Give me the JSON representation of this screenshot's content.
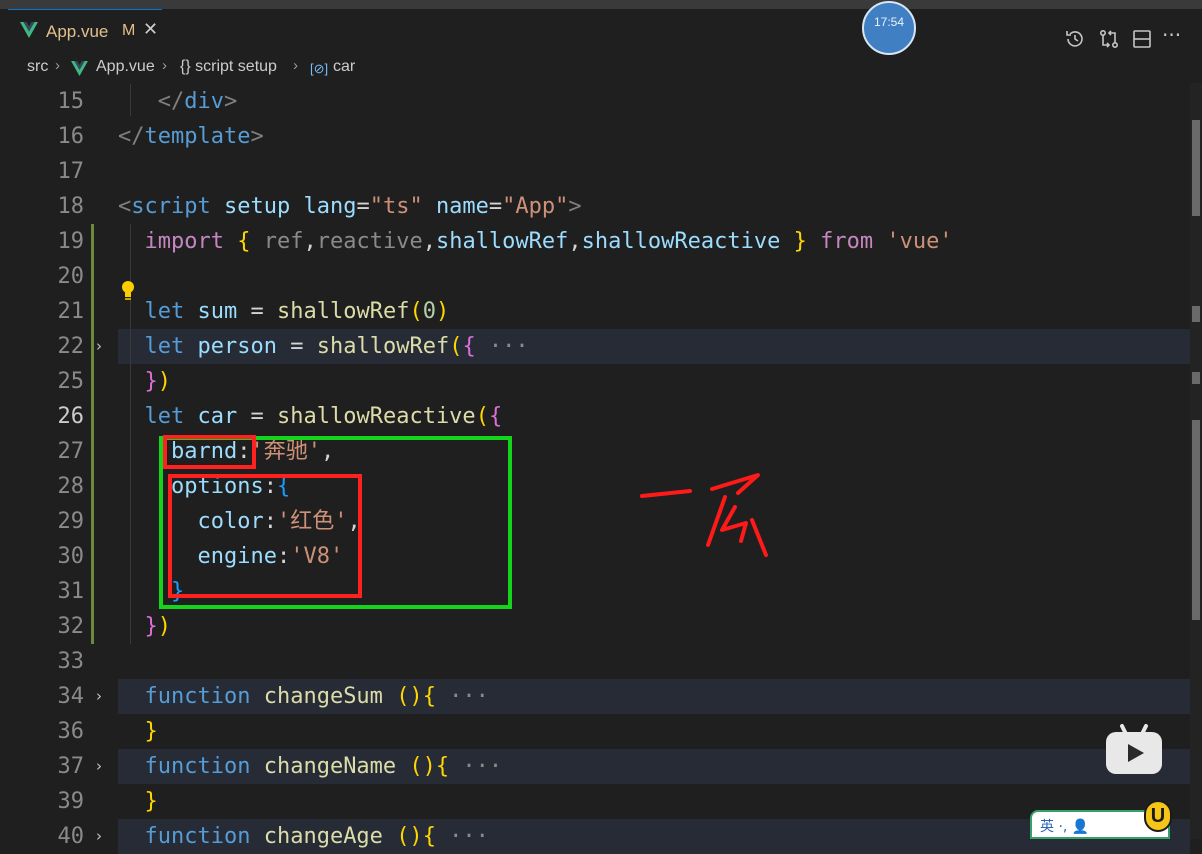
{
  "tab": {
    "label": "App.vue",
    "modified": "M",
    "close": "✕"
  },
  "clock": "17:54",
  "breadcrumb": {
    "items": [
      "src",
      "App.vue",
      "{} script setup",
      "car"
    ]
  },
  "annotation": {
    "handwriting": "一层"
  },
  "ime": {
    "text": "英 ·, 👤",
    "badge": "U"
  },
  "editor": {
    "current_line": "26",
    "lines": [
      {
        "n": "15",
        "tokens": [
          [
            "   ",
            ""
          ],
          [
            "</",
            "t-tag"
          ],
          [
            "div",
            "t-tagname"
          ],
          [
            ">",
            "t-tag"
          ]
        ]
      },
      {
        "n": "16",
        "tokens": [
          [
            "</",
            "t-tag"
          ],
          [
            "template",
            "t-tagname"
          ],
          [
            ">",
            "t-tag"
          ]
        ]
      },
      {
        "n": "17",
        "tokens": []
      },
      {
        "n": "18",
        "tokens": [
          [
            "<",
            "t-tag"
          ],
          [
            "script",
            "t-tagname"
          ],
          [
            " ",
            ""
          ],
          [
            "setup",
            "t-attr"
          ],
          [
            " ",
            ""
          ],
          [
            "lang",
            "t-attr"
          ],
          [
            "=",
            ""
          ],
          [
            "\"ts\"",
            "t-str"
          ],
          [
            " ",
            ""
          ],
          [
            "name",
            "t-attr"
          ],
          [
            "=",
            ""
          ],
          [
            "\"App\"",
            "t-str"
          ],
          [
            ">",
            "t-tag"
          ]
        ]
      },
      {
        "n": "19",
        "tokens": [
          [
            "  ",
            ""
          ],
          [
            "import",
            "t-imp"
          ],
          [
            " ",
            ""
          ],
          [
            "{",
            "t-b1"
          ],
          [
            " ",
            ""
          ],
          [
            "ref",
            "t-dim"
          ],
          [
            ",",
            ""
          ],
          [
            "reactive",
            "t-dim"
          ],
          [
            ",",
            ""
          ],
          [
            "shallowRef",
            "t-var"
          ],
          [
            ",",
            ""
          ],
          [
            "shallowReactive",
            "t-var"
          ],
          [
            " ",
            ""
          ],
          [
            "}",
            "t-b1"
          ],
          [
            " ",
            ""
          ],
          [
            "from",
            "t-imp"
          ],
          [
            " ",
            ""
          ],
          [
            "'vue'",
            "t-str"
          ]
        ]
      },
      {
        "n": "20",
        "tokens": []
      },
      {
        "n": "21",
        "tokens": [
          [
            "  ",
            ""
          ],
          [
            "let",
            "t-kw"
          ],
          [
            " ",
            ""
          ],
          [
            "sum",
            "t-var"
          ],
          [
            " = ",
            ""
          ],
          [
            "shallowRef",
            "t-fn"
          ],
          [
            "(",
            "t-b1"
          ],
          [
            "0",
            "t-num"
          ],
          [
            ")",
            "t-b1"
          ]
        ]
      },
      {
        "n": "22",
        "fold": true,
        "hl": true,
        "tokens": [
          [
            "  ",
            ""
          ],
          [
            "let",
            "t-kw"
          ],
          [
            " ",
            ""
          ],
          [
            "person",
            "t-var"
          ],
          [
            " = ",
            ""
          ],
          [
            "shallowRef",
            "t-fn"
          ],
          [
            "(",
            "t-b1"
          ],
          [
            "{",
            "t-b2"
          ],
          [
            " ···",
            "t-dim"
          ]
        ]
      },
      {
        "n": "25",
        "tokens": [
          [
            "  ",
            ""
          ],
          [
            "}",
            "t-b2"
          ],
          [
            ")",
            "t-b1"
          ]
        ]
      },
      {
        "n": "26",
        "tokens": [
          [
            "  ",
            ""
          ],
          [
            "let",
            "t-kw"
          ],
          [
            " ",
            ""
          ],
          [
            "car",
            "t-var"
          ],
          [
            " = ",
            ""
          ],
          [
            "shallowReactive",
            "t-fn"
          ],
          [
            "(",
            "t-b1"
          ],
          [
            "{",
            "t-b2"
          ]
        ]
      },
      {
        "n": "27",
        "tokens": [
          [
            "    ",
            ""
          ],
          [
            "barnd",
            "t-prop"
          ],
          [
            ":",
            ""
          ],
          [
            "'奔驰'",
            "t-str"
          ],
          [
            ",",
            ""
          ]
        ]
      },
      {
        "n": "28",
        "tokens": [
          [
            "    ",
            ""
          ],
          [
            "options",
            "t-prop"
          ],
          [
            ":",
            ""
          ],
          [
            "{",
            "t-b3"
          ]
        ]
      },
      {
        "n": "29",
        "tokens": [
          [
            "      ",
            ""
          ],
          [
            "color",
            "t-prop"
          ],
          [
            ":",
            ""
          ],
          [
            "'红色'",
            "t-str"
          ],
          [
            ",",
            ""
          ]
        ]
      },
      {
        "n": "30",
        "tokens": [
          [
            "      ",
            ""
          ],
          [
            "engine",
            "t-prop"
          ],
          [
            ":",
            ""
          ],
          [
            "'V8'",
            "t-str"
          ]
        ]
      },
      {
        "n": "31",
        "tokens": [
          [
            "    ",
            ""
          ],
          [
            "}",
            "t-b3"
          ]
        ]
      },
      {
        "n": "32",
        "tokens": [
          [
            "  ",
            ""
          ],
          [
            "}",
            "t-b2"
          ],
          [
            ")",
            "t-b1"
          ]
        ]
      },
      {
        "n": "33",
        "tokens": []
      },
      {
        "n": "34",
        "fold": true,
        "hl": true,
        "tokens": [
          [
            "  ",
            ""
          ],
          [
            "function",
            "t-kw"
          ],
          [
            " ",
            ""
          ],
          [
            "changeSum",
            "t-fn"
          ],
          [
            " ",
            ""
          ],
          [
            "()",
            "t-b1"
          ],
          [
            "{",
            "t-b1"
          ],
          [
            " ···",
            "t-dim"
          ]
        ]
      },
      {
        "n": "36",
        "tokens": [
          [
            "  ",
            ""
          ],
          [
            "}",
            "t-b1"
          ]
        ]
      },
      {
        "n": "37",
        "fold": true,
        "hl": true,
        "tokens": [
          [
            "  ",
            ""
          ],
          [
            "function",
            "t-kw"
          ],
          [
            " ",
            ""
          ],
          [
            "changeName",
            "t-fn"
          ],
          [
            " ",
            ""
          ],
          [
            "()",
            "t-b1"
          ],
          [
            "{",
            "t-b1"
          ],
          [
            " ···",
            "t-dim"
          ]
        ]
      },
      {
        "n": "39",
        "tokens": [
          [
            "  ",
            ""
          ],
          [
            "}",
            "t-b1"
          ]
        ]
      },
      {
        "n": "40",
        "fold": true,
        "hl": true,
        "tokens": [
          [
            "  ",
            ""
          ],
          [
            "function",
            "t-kw"
          ],
          [
            " ",
            ""
          ],
          [
            "changeAge",
            "t-fn"
          ],
          [
            " ",
            ""
          ],
          [
            "()",
            "t-b1"
          ],
          [
            "{",
            "t-b1"
          ],
          [
            " ···",
            "t-dim"
          ]
        ]
      }
    ]
  }
}
